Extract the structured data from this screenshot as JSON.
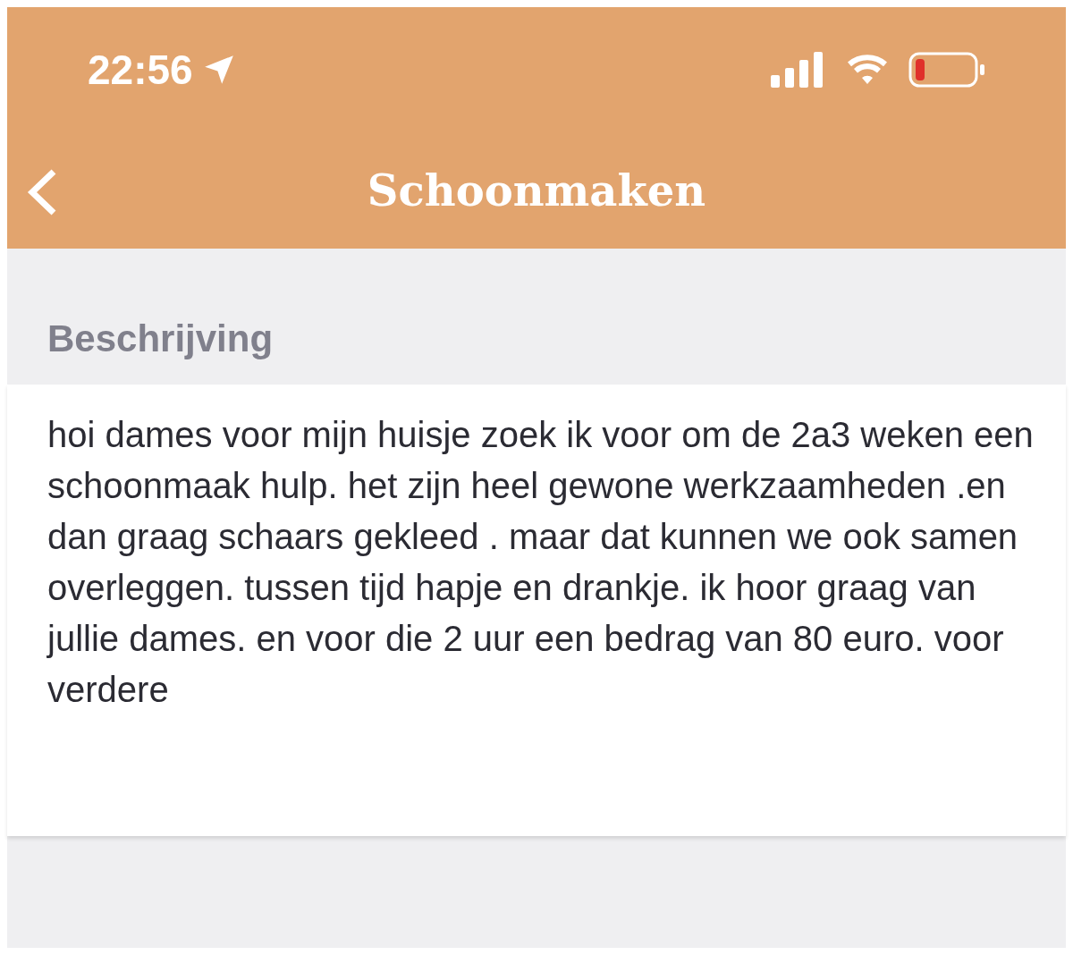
{
  "status_bar": {
    "time": "22:56"
  },
  "header": {
    "title": "Schoonmaken"
  },
  "section": {
    "label": "Beschrijving"
  },
  "description": "hoi dames voor mijn huisje zoek ik voor om de 2a3 weken een schoonmaak hulp. het zijn heel gewone werkzaamheden .en dan graag schaars gekleed . maar dat kunnen we ook samen overleggen. tussen tijd hapje en drankje. ik hoor graag van jullie dames. en voor die 2 uur een bedrag van 80 euro. voor verdere"
}
